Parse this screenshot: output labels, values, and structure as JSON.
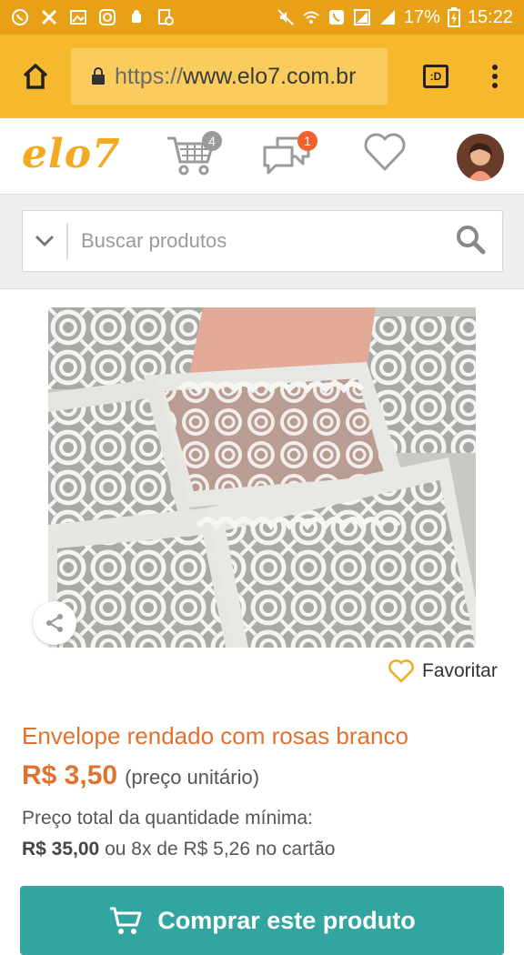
{
  "statusbar": {
    "battery": "17%",
    "time": "15:22"
  },
  "browser": {
    "url_scheme": "https://",
    "url_host": "www.elo7.com.br",
    "tabs_label": ":D"
  },
  "header": {
    "logo": "elo7",
    "cart_count": "4",
    "messages_count": "1"
  },
  "search": {
    "placeholder": "Buscar produtos"
  },
  "product": {
    "favorite_label": "Favoritar",
    "title": "Envelope rendado com rosas branco",
    "price": "R$ 3,50",
    "price_note": "(preço unitário)",
    "total_label": "Preço total da quantidade mínima:",
    "total_price": "R$ 35,00",
    "installments": "ou 8x de R$ 5,26 no cartão",
    "buy_label": "Comprar este produto"
  },
  "colors": {
    "status_bar": "#e8a117",
    "browser_bar": "#f6b92e",
    "brand": "#f3a920",
    "accent": "#e0712f",
    "buy_button": "#33a5a0"
  }
}
